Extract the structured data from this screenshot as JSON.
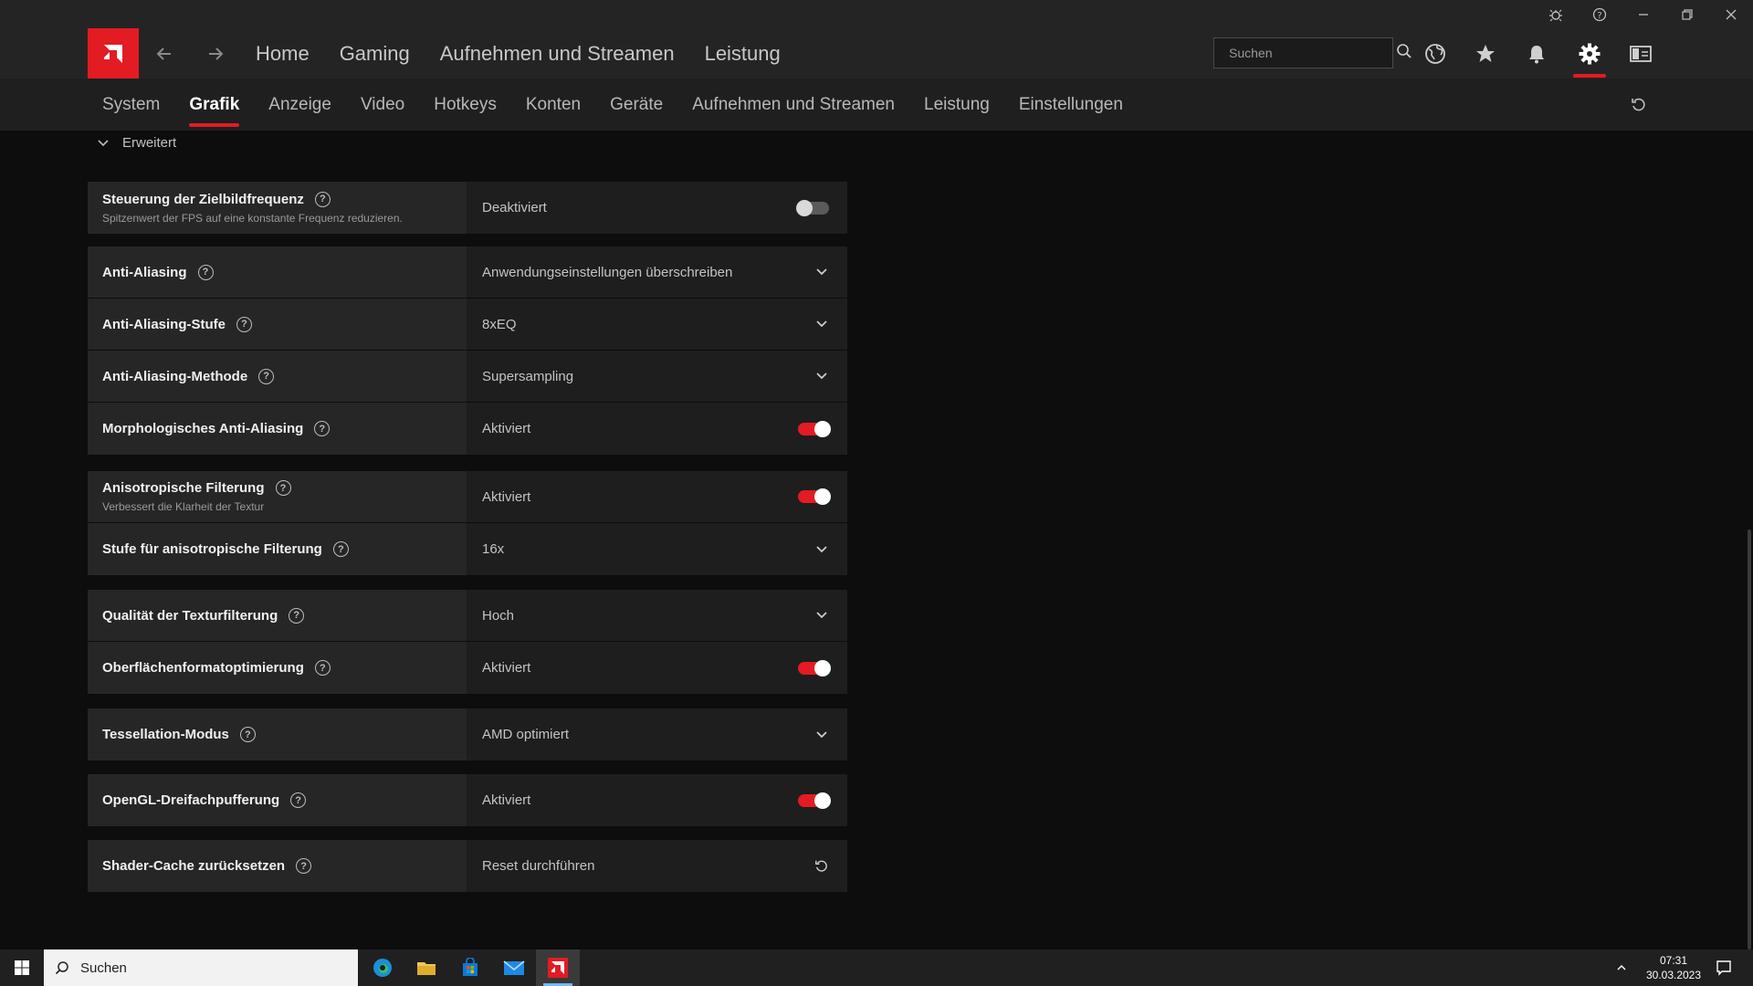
{
  "topnav": {
    "items": [
      "Home",
      "Gaming",
      "Aufnehmen und Streamen",
      "Leistung"
    ],
    "search_placeholder": "Suchen"
  },
  "subnav": {
    "items": [
      "System",
      "Grafik",
      "Anzeige",
      "Video",
      "Hotkeys",
      "Konten",
      "Geräte",
      "Aufnehmen und Streamen",
      "Leistung",
      "Einstellungen"
    ],
    "active": "Grafik"
  },
  "section": {
    "label": "Erweitert"
  },
  "groups": [
    {
      "rows": [
        {
          "label": "Steuerung der Zielbildfrequenz",
          "desc": "Spitzenwert der FPS auf eine konstante Frequenz reduzieren.",
          "value": "Deaktiviert",
          "control": "toggle-off"
        }
      ]
    },
    {
      "rows": [
        {
          "label": "Anti-Aliasing",
          "value": "Anwendungseinstellungen überschreiben",
          "control": "dropdown"
        },
        {
          "label": "Anti-Aliasing-Stufe",
          "value": "8xEQ",
          "control": "dropdown"
        },
        {
          "label": "Anti-Aliasing-Methode",
          "value": "Supersampling",
          "control": "dropdown"
        },
        {
          "label": "Morphologisches Anti-Aliasing",
          "value": "Aktiviert",
          "control": "toggle-on"
        }
      ]
    },
    {
      "rows": [
        {
          "label": "Anisotropische Filterung",
          "desc": "Verbessert die Klarheit der Textur",
          "value": "Aktiviert",
          "control": "toggle-on"
        },
        {
          "label": "Stufe für anisotropische Filterung",
          "value": "16x",
          "control": "dropdown"
        }
      ]
    },
    {
      "rows": [
        {
          "label": "Qualität der Texturfilterung",
          "value": "Hoch",
          "control": "dropdown"
        },
        {
          "label": "Oberflächenformatoptimierung",
          "value": "Aktiviert",
          "control": "toggle-on"
        }
      ]
    },
    {
      "rows": [
        {
          "label": "Tessellation-Modus",
          "value": "AMD optimiert",
          "control": "dropdown"
        }
      ]
    },
    {
      "rows": [
        {
          "label": "OpenGL-Dreifachpufferung",
          "value": "Aktiviert",
          "control": "toggle-on"
        }
      ]
    },
    {
      "rows": [
        {
          "label": "Shader-Cache zurücksetzen",
          "value": "Reset durchführen",
          "control": "reset"
        }
      ]
    }
  ],
  "taskbar": {
    "search_label": "Suchen",
    "time": "07:31",
    "date": "30.03.2023"
  },
  "icons": {
    "help": "?",
    "chevron": "chevron-down-icon",
    "reset": "reset-icon"
  },
  "colors": {
    "accent": "#e31b23",
    "background": "#0d0d0d",
    "panel": "#262626"
  }
}
